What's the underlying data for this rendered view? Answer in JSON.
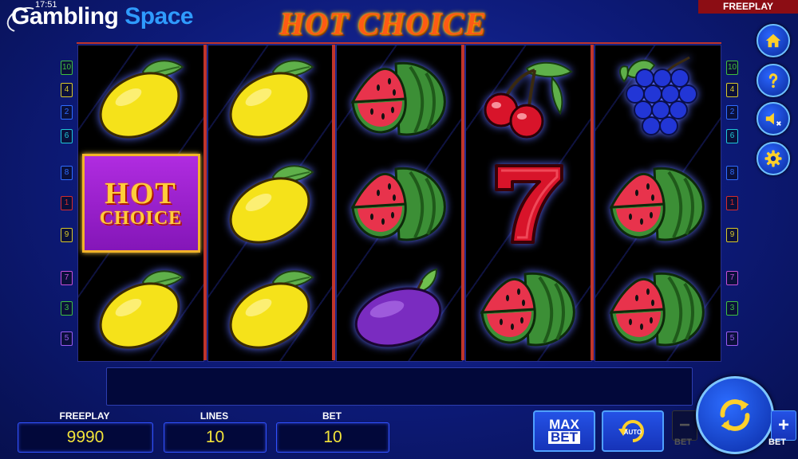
{
  "status_bar": {
    "time": "17:51",
    "mode_tag": "FREEPLAY"
  },
  "brand": {
    "logo_part1": "Gambling",
    "logo_part2": "Space"
  },
  "game": {
    "title": "HOT CHOICE"
  },
  "paylines_left": [
    {
      "num": "10",
      "color": "#3fbf3f"
    },
    {
      "num": "4",
      "color": "#d8c829"
    },
    {
      "num": "2",
      "color": "#2f6cff"
    },
    {
      "num": "6",
      "color": "#1fc6d6"
    },
    {
      "num": "8",
      "color": "#2f6cff"
    },
    {
      "num": "1",
      "color": "#d62b2b"
    },
    {
      "num": "9",
      "color": "#d8c829"
    },
    {
      "num": "7",
      "color": "#c64fd6"
    },
    {
      "num": "3",
      "color": "#3fbf3f"
    },
    {
      "num": "5",
      "color": "#9a5cf0"
    }
  ],
  "paylines_right": [
    {
      "num": "10",
      "color": "#3fbf3f"
    },
    {
      "num": "4",
      "color": "#d8c829"
    },
    {
      "num": "2",
      "color": "#2f6cff"
    },
    {
      "num": "6",
      "color": "#1fc6d6"
    },
    {
      "num": "8",
      "color": "#2f6cff"
    },
    {
      "num": "1",
      "color": "#d62b2b"
    },
    {
      "num": "9",
      "color": "#d8c829"
    },
    {
      "num": "7",
      "color": "#c64fd6"
    },
    {
      "num": "3",
      "color": "#3fbf3f"
    },
    {
      "num": "5",
      "color": "#9a5cf0"
    }
  ],
  "reels": [
    [
      "lemon",
      "hot-choice",
      "lemon"
    ],
    [
      "lemon",
      "lemon",
      "lemon"
    ],
    [
      "watermelon",
      "watermelon",
      "plum"
    ],
    [
      "cherries",
      "seven",
      "watermelon"
    ],
    [
      "grapes",
      "watermelon",
      "watermelon"
    ]
  ],
  "hot_choice_symbol": {
    "line1": "HOT",
    "line2": "CHOICE"
  },
  "menu": [
    {
      "name": "home-icon"
    },
    {
      "name": "help-icon"
    },
    {
      "name": "sound-muted-icon"
    },
    {
      "name": "settings-gear-icon"
    }
  ],
  "bottom": {
    "freeplay_label": "FREEPLAY",
    "freeplay_value": "9990",
    "lines_label": "LINES",
    "lines_value": "10",
    "bet_label": "BET",
    "bet_value": "10"
  },
  "buttons": {
    "max_label": "MAX",
    "bet_label": "BET",
    "auto_label": "AUTO",
    "bet_minus_symbol": "−",
    "bet_minus_label": "BET",
    "bet_plus_symbol": "+",
    "bet_plus_label": "BET"
  },
  "colors": {
    "accent_red": "#c0352b",
    "value_yellow": "#f2e33a",
    "panel_blue": "#3052ff"
  }
}
